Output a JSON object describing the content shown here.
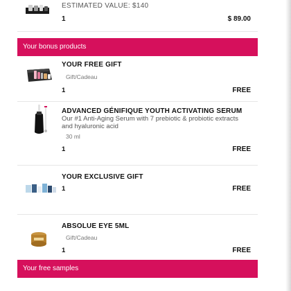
{
  "top_item": {
    "estimated_value": "ESTIMATED VALUE: $140",
    "qty": "1",
    "price": "$ 89.00"
  },
  "bonus_section": {
    "title": "Your bonus products"
  },
  "products": [
    {
      "name": "YOUR FREE GIFT",
      "sub": "Gift/Cadeau",
      "qty": "1",
      "price": "FREE"
    },
    {
      "name": "ADVANCED GÉNIFIQUE YOUTH ACTIVATING SERUM",
      "desc": "Our #1 Anti-Aging Serum with 7 prebiotic & probiotic extracts and hyaluronic acid",
      "sub": "30 ml",
      "qty": "1",
      "price": "FREE"
    },
    {
      "name": "YOUR EXCLUSIVE GIFT",
      "qty": "1",
      "price": "FREE"
    },
    {
      "name": "ABSOLUE EYE 5ML",
      "sub": "Gift/Cadeau",
      "qty": "1",
      "price": "FREE"
    }
  ],
  "samples_section": {
    "title": "Your free samples"
  },
  "colors": {
    "accent": "#d6105c"
  }
}
